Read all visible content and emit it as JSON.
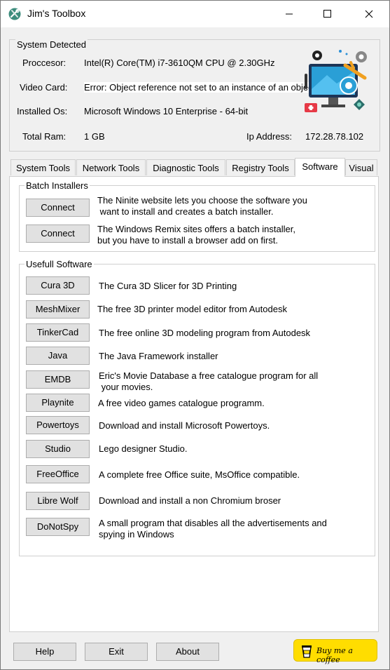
{
  "window": {
    "title": "Jim's Toolbox",
    "minimize_icon": "minimize-icon",
    "maximize_icon": "maximize-icon",
    "close_icon": "close-icon"
  },
  "system": {
    "group_label": "System Detected",
    "processor_label": "Proccesor:",
    "processor_value": "Intel(R) Core(TM) i7-3610QM CPU @ 2.30GHz",
    "video_label": "Video Card:",
    "video_value": "Error: Object reference not set to an instance of an object.",
    "os_label": "Installed Os:",
    "os_value": "Microsoft Windows 10 Enterprise - 64-bit",
    "ram_label": "Total Ram:",
    "ram_value": "1 GB",
    "ip_label": "Ip Address:",
    "ip_value": "172.28.78.102",
    "illustration": "computer-repair-illustration-icon"
  },
  "tabs": [
    {
      "label": "System Tools"
    },
    {
      "label": "Network Tools"
    },
    {
      "label": "Diagnostic Tools"
    },
    {
      "label": "Registry Tools"
    },
    {
      "label": "Software"
    },
    {
      "label": "Visual"
    }
  ],
  "active_tab": "Software",
  "batch": {
    "group_label": "Batch Installers",
    "items": [
      {
        "button": "Connect",
        "line1": "The Ninite website lets you choose the software you",
        "line2": " want to install and creates a batch installer."
      },
      {
        "button": "Connect",
        "line1": "The Windows Remix sites offers a batch installer,",
        "line2": "but you have to install a browser add on first."
      }
    ]
  },
  "software": {
    "group_label": "Usefull Software",
    "items": [
      {
        "button": "Cura 3D",
        "line1": "The Cura 3D Slicer for 3D Printing",
        "line2": ""
      },
      {
        "button": "MeshMixer",
        "line1": "The free 3D printer model editor from Autodesk",
        "line2": ""
      },
      {
        "button": "TinkerCad",
        "line1": "The free online 3D modeling program from Autodesk",
        "line2": ""
      },
      {
        "button": "Java",
        "line1": "The Java Framework installer",
        "line2": ""
      },
      {
        "button": "EMDB",
        "line1": "Eric's Movie Database a free catalogue program for all",
        "line2": " your movies."
      },
      {
        "button": "Playnite",
        "line1": "A free video games catalogue programm.",
        "line2": ""
      },
      {
        "button": "Powertoys",
        "line1": "Download and install Microsoft Powertoys.",
        "line2": ""
      },
      {
        "button": "Studio",
        "line1": "Lego designer Studio.",
        "line2": ""
      },
      {
        "button": "FreeOffice",
        "line1": "A complete free Office suite, MsOffice compatible.",
        "line2": ""
      },
      {
        "button": "Libre Wolf",
        "line1": "Download and install a non Chromium broser",
        "line2": ""
      },
      {
        "button": "DoNotSpy",
        "line1": "A small program that disables all the advertisements and",
        "line2": "spying in Windows"
      }
    ]
  },
  "footer": {
    "help": "Help",
    "exit": "Exit",
    "about": "About",
    "coffee": "Buy me a coffee",
    "coffee_icon": "coffee-cup-icon"
  },
  "colors": {
    "window_bg": "#f0f0f0",
    "panel_bg": "#ffffff",
    "button_bg": "#e1e1e1",
    "coffee_bg": "#ffdd00",
    "error_highlight": "#ffffff"
  }
}
